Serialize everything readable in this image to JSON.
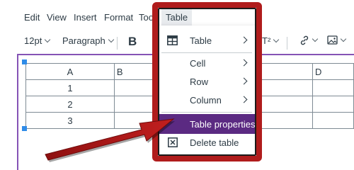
{
  "menubar": {
    "items": [
      "Edit",
      "View",
      "Insert",
      "Format",
      "Tools",
      "Table"
    ]
  },
  "toolbar": {
    "font_size": "12pt",
    "block_format": "Paragraph",
    "bold_label": "B",
    "superscript_label": "T²"
  },
  "table": {
    "header": [
      "A",
      "B",
      "",
      "D"
    ],
    "rows": [
      [
        "1",
        "",
        "",
        ""
      ],
      [
        "2",
        "",
        "",
        ""
      ],
      [
        "3",
        "",
        "",
        ""
      ]
    ]
  },
  "dropdown": {
    "items": [
      {
        "label": "Table",
        "icon": "table-icon",
        "submenu": true
      },
      {
        "label": "Cell",
        "submenu": true
      },
      {
        "label": "Row",
        "submenu": true
      },
      {
        "label": "Column",
        "submenu": true
      },
      {
        "label": "Table properties",
        "selected": true
      },
      {
        "label": "Delete table",
        "icon": "delete-table-icon"
      }
    ]
  },
  "colors": {
    "callout_red": "#b01c1c",
    "selected_purple": "#5b2a82",
    "editor_border": "#8553b5",
    "handle_blue": "#2f8ce8"
  }
}
